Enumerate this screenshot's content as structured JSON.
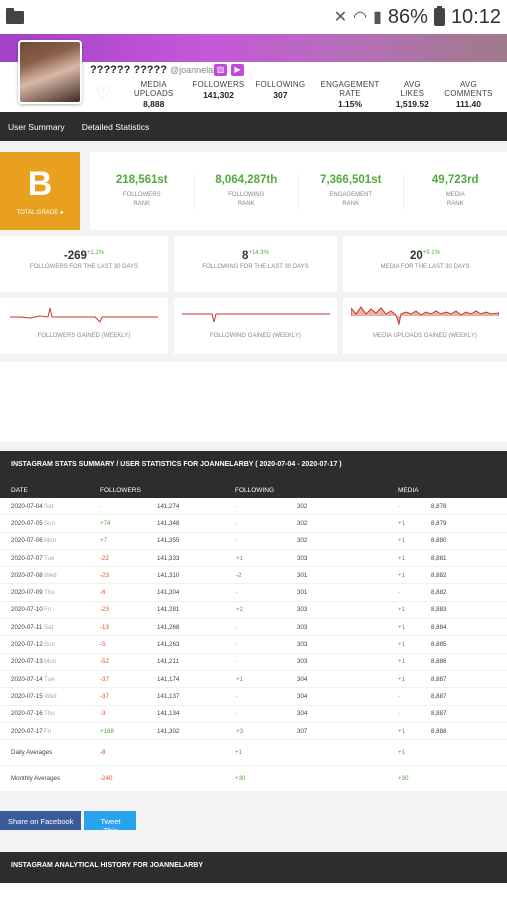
{
  "status_bar": {
    "battery": "86%",
    "time": "10:12"
  },
  "profile": {
    "name": "?????? ?????",
    "username": "@joannelarby"
  },
  "header_stats": [
    {
      "label": "MEDIA UPLOADS",
      "value": "8,888"
    },
    {
      "label": "FOLLOWERS",
      "value": "141,302"
    },
    {
      "label": "FOLLOWING",
      "value": "307"
    },
    {
      "label": "ENGAGEMENT RATE",
      "value": "1.15%"
    },
    {
      "label": "AVG LIKES",
      "value": "1,519.52"
    },
    {
      "label": "AVG COMMENTS",
      "value": "111.40"
    }
  ],
  "tabs": {
    "user_summary": "User Summary",
    "detailed": "Detailed Statistics"
  },
  "grade": {
    "letter": "B",
    "label": "TOTAL GRADE"
  },
  "ranks": [
    {
      "value": "218,561st",
      "label1": "FOLLOWERS",
      "label2": "RANK"
    },
    {
      "value": "8,064,287th",
      "label1": "FOLLOWING",
      "label2": "RANK"
    },
    {
      "value": "7,366,501st",
      "label1": "ENGAGEMENT",
      "label2": "RANK"
    },
    {
      "value": "49,723rd",
      "label1": "MEDIA",
      "label2": "RANK"
    }
  ],
  "changes": [
    {
      "value": "-269",
      "pct": "+1.1%",
      "label": "FOLLOWERS FOR THE LAST 30 DAYS"
    },
    {
      "value": "8",
      "pct": "+14.3%",
      "label": "FOLLOWING FOR THE LAST 30 DAYS"
    },
    {
      "value": "20",
      "pct": "+9.1%",
      "label": "MEDIA FOR THE LAST 30 DAYS"
    }
  ],
  "sparks": [
    {
      "label": "FOLLOWERS GAINED (WEEKLY)"
    },
    {
      "label": "FOLLOWING GAINED (WEEKLY)"
    },
    {
      "label": "MEDIA UPLOADS GAINED (WEEKLY)"
    }
  ],
  "table_title": "INSTAGRAM STATS SUMMARY / USER STATISTICS FOR JOANNELARBY ( 2020-07-04 - 2020-07-17 )",
  "columns": {
    "date": "DATE",
    "followers": "FOLLOWERS",
    "following": "FOLLOWING",
    "media": "MEDIA"
  },
  "rows": [
    {
      "date": "2020-07-04",
      "day": "Sat",
      "fd": "-",
      "f": "141,274",
      "gd": "-",
      "g": "302",
      "md": "-",
      "m": "8,878"
    },
    {
      "date": "2020-07-05",
      "day": "Sun",
      "fd": "+74",
      "f": "141,348",
      "gd": "-",
      "g": "302",
      "md": "+1",
      "m": "8,879"
    },
    {
      "date": "2020-07-06",
      "day": "Mon",
      "fd": "+7",
      "f": "141,355",
      "gd": "-",
      "g": "302",
      "md": "+1",
      "m": "8,880"
    },
    {
      "date": "2020-07-07",
      "day": "Tue",
      "fd": "-22",
      "f": "141,333",
      "gd": "+1",
      "g": "303",
      "md": "+1",
      "m": "8,881"
    },
    {
      "date": "2020-07-08",
      "day": "Wed",
      "fd": "-23",
      "f": "141,310",
      "gd": "-2",
      "g": "301",
      "md": "+1",
      "m": "8,882"
    },
    {
      "date": "2020-07-09",
      "day": "Thu",
      "fd": "-6",
      "f": "141,304",
      "gd": "-",
      "g": "301",
      "md": "-",
      "m": "8,882"
    },
    {
      "date": "2020-07-10",
      "day": "Fri",
      "fd": "-23",
      "f": "141,281",
      "gd": "+2",
      "g": "303",
      "md": "+1",
      "m": "8,883"
    },
    {
      "date": "2020-07-11",
      "day": "Sat",
      "fd": "-13",
      "f": "141,268",
      "gd": "-",
      "g": "303",
      "md": "+1",
      "m": "8,884"
    },
    {
      "date": "2020-07-12",
      "day": "Sun",
      "fd": "-5",
      "f": "141,263",
      "gd": "-",
      "g": "303",
      "md": "+1",
      "m": "8,885"
    },
    {
      "date": "2020-07-13",
      "day": "Mon",
      "fd": "-52",
      "f": "141,211",
      "gd": "-",
      "g": "303",
      "md": "+1",
      "m": "8,886"
    },
    {
      "date": "2020-07-14",
      "day": "Tue",
      "fd": "-37",
      "f": "141,174",
      "gd": "+1",
      "g": "304",
      "md": "+1",
      "m": "8,887"
    },
    {
      "date": "2020-07-15",
      "day": "Wed",
      "fd": "-37",
      "f": "141,137",
      "gd": "-",
      "g": "304",
      "md": "-",
      "m": "8,887"
    },
    {
      "date": "2020-07-16",
      "day": "Thu",
      "fd": "-3",
      "f": "141,134",
      "gd": "-",
      "g": "304",
      "md": "-",
      "m": "8,887"
    },
    {
      "date": "2020-07-17",
      "day": "Fri",
      "fd": "+168",
      "f": "141,302",
      "gd": "+3",
      "g": "307",
      "md": "+1",
      "m": "8,888"
    }
  ],
  "daily": {
    "label": "Daily Averages",
    "f": "-8",
    "g": "+1",
    "m": "+1"
  },
  "monthly": {
    "label": "Monthly Averages",
    "f": "-240",
    "g": "+30",
    "m": "+30"
  },
  "share": {
    "facebook": "Share on Facebook",
    "twitter": "Tweet This"
  },
  "history_title": "INSTAGRAM ANALYTICAL HISTORY FOR JOANNELARBY",
  "colors": {
    "accent": "#c24ad6",
    "grade": "#e9a01e",
    "positive": "#53a93f",
    "negative": "#d9531e",
    "spark": "#c0392b"
  }
}
